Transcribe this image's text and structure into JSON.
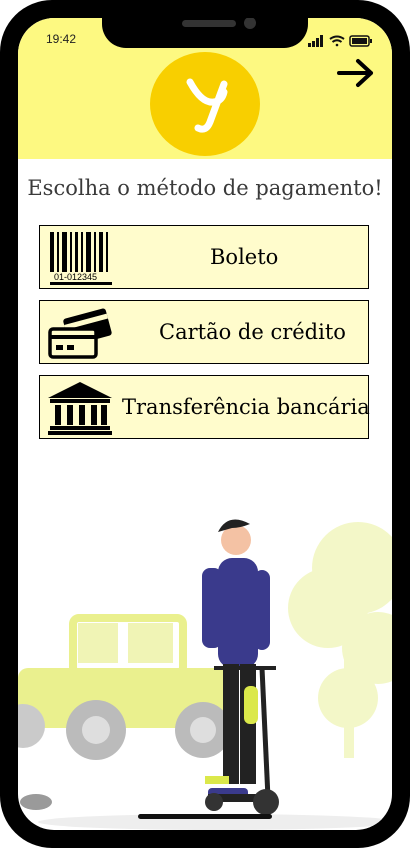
{
  "status_bar": {
    "time": "19:42"
  },
  "header": {
    "logo_letter": "y",
    "next_icon": "arrow-right-icon"
  },
  "page": {
    "title": "Escolha o método de pagamento!"
  },
  "payment_methods": [
    {
      "label": "Boleto",
      "icon": "barcode-icon",
      "barcode_number": "01-012345"
    },
    {
      "label": "Cartão de crédito",
      "icon": "credit-cards-icon"
    },
    {
      "label": "Transferência bancária",
      "icon": "bank-icon"
    }
  ],
  "colors": {
    "header_bg": "#fdf981",
    "logo_bg": "#f8cf00",
    "option_bg": "#fffccc",
    "accent_green": "#e3ee6a"
  }
}
